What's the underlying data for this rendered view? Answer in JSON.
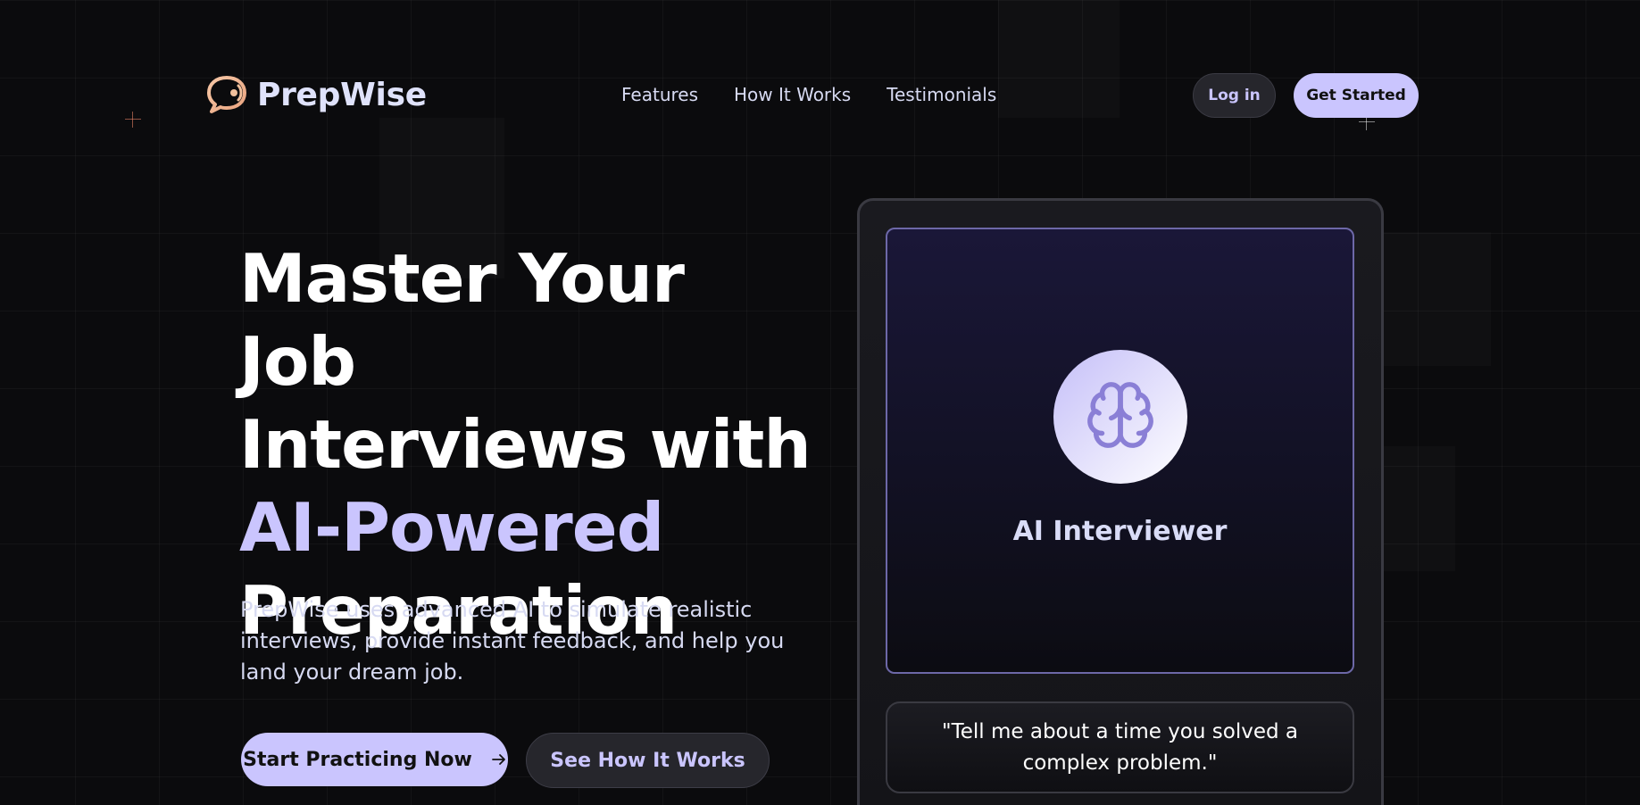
{
  "brand": {
    "name": "PrepWise",
    "accent_color": "#cac5fe",
    "logo_icon": "chat-bubble-icon"
  },
  "nav": {
    "items": [
      {
        "label": "Features"
      },
      {
        "label": "How It Works"
      },
      {
        "label": "Testimonials"
      }
    ]
  },
  "header": {
    "login_label": "Log in",
    "get_started_label": "Get Started"
  },
  "hero": {
    "title_line1": "Master Your Job",
    "title_line2": "Interviews with",
    "title_accent": "AI-Powered",
    "title_line4": "Preparation",
    "subtitle": "PrepWise uses advanced AI to simulate realistic interviews, provide instant feedback, and help you land your dream job.",
    "primary_cta": "Start Practicing Now",
    "primary_cta_icon": "arrow-right-icon",
    "secondary_cta": "See How It Works"
  },
  "interview_card": {
    "interviewer_icon": "brain-icon",
    "interviewer_label": "AI Interviewer",
    "question": "\"Tell me about a time you solved a complex problem.\""
  }
}
